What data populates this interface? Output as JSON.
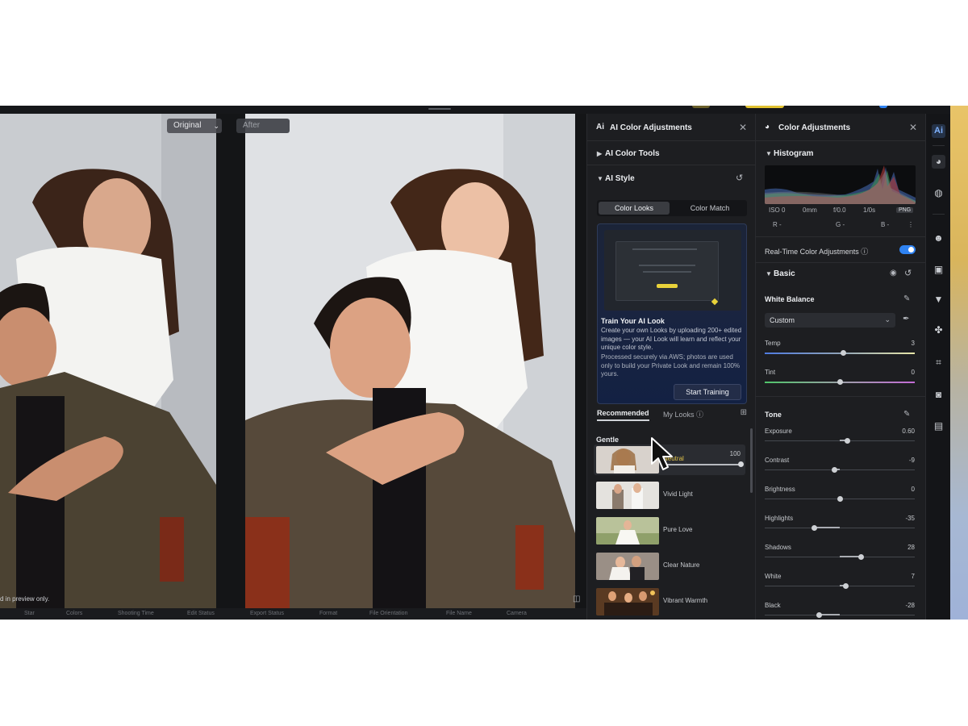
{
  "canvas": {
    "original_label": "Original",
    "after_label": "After",
    "preview_note": "d in preview only.",
    "bottom_items": [
      "Star",
      "Colors",
      "Shooting Time",
      "Edit Status",
      "Export Status",
      "Format",
      "File Orientation",
      "File Name",
      "Camera"
    ]
  },
  "ai_panel": {
    "title": "AI Color Adjustments",
    "tools_section": "AI Color Tools",
    "style_section": "AI Style",
    "seg_color_looks": "Color Looks",
    "seg_color_match": "Color Match",
    "train": {
      "title": "Train Your AI Look",
      "description": "Create your own Looks by uploading 200+ edited images — your AI Look will learn and reflect your unique color style.",
      "note": "Processed securely via AWS; photos are used only to build your Private Look and remain 100% yours.",
      "button": "Start Training"
    },
    "tab_recommended": "Recommended",
    "tab_my_looks": "My Looks",
    "group": "Gentle",
    "looks": [
      {
        "name": "Neutral",
        "value": "100",
        "selected": true,
        "strength": 1.0
      },
      {
        "name": "Vivid Light"
      },
      {
        "name": "Pure Love"
      },
      {
        "name": "Clear Nature"
      },
      {
        "name": "Vibrant Warmth"
      }
    ]
  },
  "color_panel": {
    "title": "Color Adjustments",
    "histogram_label": "Histogram",
    "exif": {
      "iso": "ISO 0",
      "focal": "0mm",
      "aperture": "f/0.0",
      "shutter": "1/0s",
      "format": "PNG"
    },
    "rgb": {
      "r": "R -",
      "g": "G -",
      "b": "B -"
    },
    "realtime_label": "Real-Time Color Adjustments",
    "realtime_on": true,
    "basic_label": "Basic",
    "white_balance_label": "White Balance",
    "wb_preset": "Custom",
    "temp": {
      "label": "Temp",
      "value": "3",
      "position": 0.52
    },
    "tint": {
      "label": "Tint",
      "value": "0",
      "position": 0.5
    },
    "tone_label": "Tone",
    "tone_sliders": [
      {
        "label": "Exposure",
        "value": "0.60",
        "position": 0.55
      },
      {
        "label": "Contrast",
        "value": "-9",
        "position": 0.46
      },
      {
        "label": "Brightness",
        "value": "0",
        "position": 0.5
      },
      {
        "label": "Highlights",
        "value": "-35",
        "position": 0.33
      },
      {
        "label": "Shadows",
        "value": "28",
        "position": 0.64
      },
      {
        "label": "White",
        "value": "7",
        "position": 0.54
      },
      {
        "label": "Black",
        "value": "-28",
        "position": 0.36
      }
    ]
  },
  "toolbar": [
    "ai-icon",
    "palette-icon",
    "texture-icon",
    "face-icon",
    "image-icon",
    "shirt-icon",
    "paw-icon",
    "crop-icon",
    "camera-icon",
    "folder-icon"
  ],
  "colors": {
    "accent": "#2f83f2",
    "selected_look": "#e2c44a",
    "train_bg": "#132143"
  }
}
